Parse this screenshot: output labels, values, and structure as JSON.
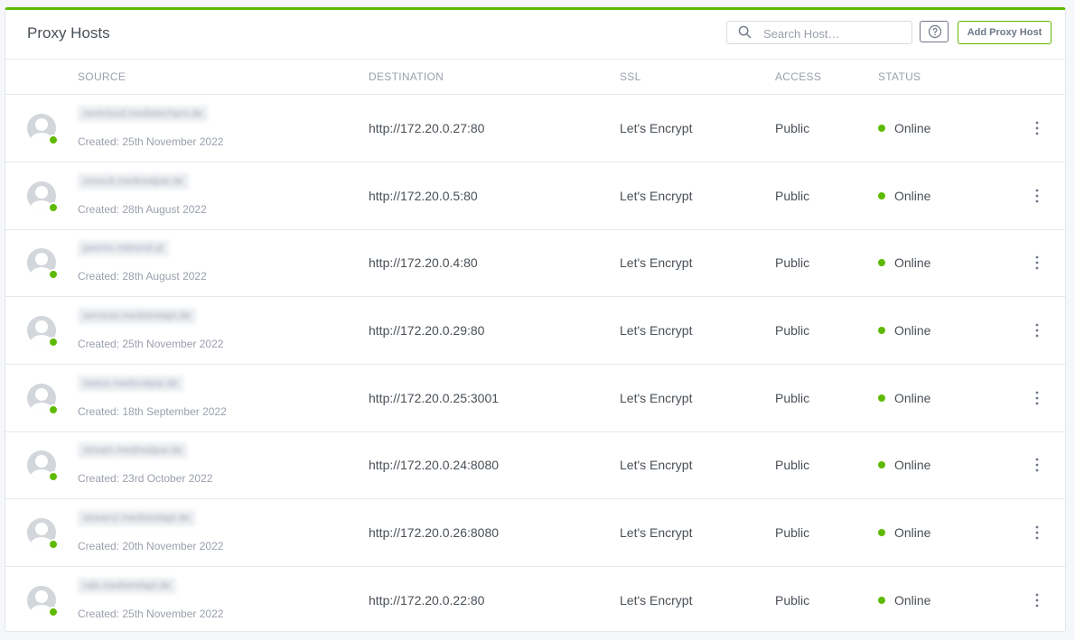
{
  "header": {
    "title": "Proxy Hosts",
    "search_placeholder": "Search Host…",
    "add_button_label": "Add Proxy Host"
  },
  "columns": {
    "source": "SOURCE",
    "destination": "DESTINATION",
    "ssl": "SSL",
    "access": "ACCESS",
    "status": "STATUS"
  },
  "rows": [
    {
      "domain": "nextcloud.mediatechpro.de",
      "created": "Created: 25th November 2022",
      "destination": "http://172.20.0.27:80",
      "ssl": "Let's Encrypt",
      "access": "Public",
      "status": "Online"
    },
    {
      "domain": "zoosuit.medirealpar.de",
      "created": "Created: 28th August 2022",
      "destination": "http://172.20.0.5:80",
      "ssl": "Let's Encrypt",
      "access": "Public",
      "status": "Online"
    },
    {
      "domain": "peomo.mbirend.at",
      "created": "Created: 28th August 2022",
      "destination": "http://172.20.0.4:80",
      "ssl": "Let's Encrypt",
      "access": "Public",
      "status": "Online"
    },
    {
      "domain": "services.medistrelapt.de",
      "created": "Created: 25th November 2022",
      "destination": "http://172.20.0.29:80",
      "ssl": "Let's Encrypt",
      "access": "Public",
      "status": "Online"
    },
    {
      "domain": "status.medocalpar.de",
      "created": "Created: 18th September 2022",
      "destination": "http://172.20.0.25:3001",
      "ssl": "Let's Encrypt",
      "access": "Public",
      "status": "Online"
    },
    {
      "domain": "stream.medirealpar.de",
      "created": "Created: 23rd October 2022",
      "destination": "http://172.20.0.24:8080",
      "ssl": "Let's Encrypt",
      "access": "Public",
      "status": "Online"
    },
    {
      "domain": "stream2.medistrelapt.de",
      "created": "Created: 20th November 2022",
      "destination": "http://172.20.0.26:8080",
      "ssl": "Let's Encrypt",
      "access": "Public",
      "status": "Online"
    },
    {
      "domain": "rabi.medistrelapt.de",
      "created": "Created: 25th November 2022",
      "destination": "http://172.20.0.22:80",
      "ssl": "Let's Encrypt",
      "access": "Public",
      "status": "Online"
    }
  ],
  "colors": {
    "accent": "#5eba00",
    "online": "#5eba00"
  },
  "icons": {
    "search": "search-icon",
    "help": "help-icon",
    "avatar": "user-avatar-icon",
    "menu": "more-vertical-icon"
  }
}
